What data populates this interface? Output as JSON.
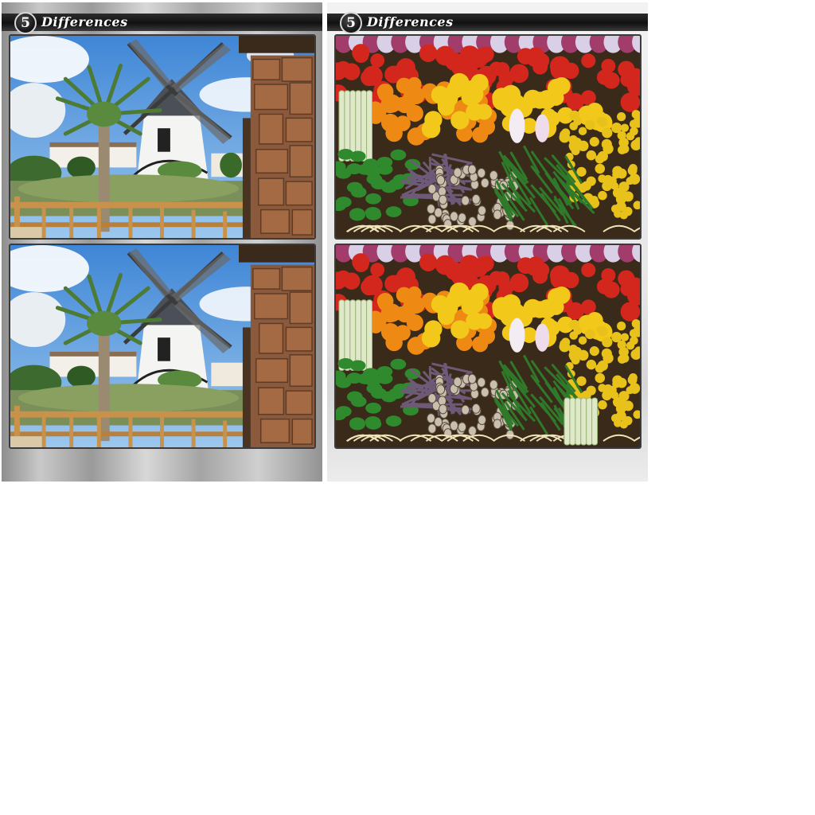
{
  "screens": [
    {
      "header": {
        "level": "5",
        "title": "Differences"
      },
      "scene": "windmill"
    },
    {
      "header": {
        "level": "5",
        "title": "Differences"
      },
      "scene": "vegetables"
    }
  ],
  "colors": {
    "header_bar": "#111111",
    "header_text": "#ffffff",
    "sky": "#4a8fd8",
    "windmill_wall": "#f4f4f2",
    "fence": "#c9924a",
    "stone_wall": "#8b5a3c",
    "tomato": "#d3261c",
    "orange": "#ee8a14",
    "lemon": "#f2c81a",
    "bean": "#2f7a2a"
  }
}
